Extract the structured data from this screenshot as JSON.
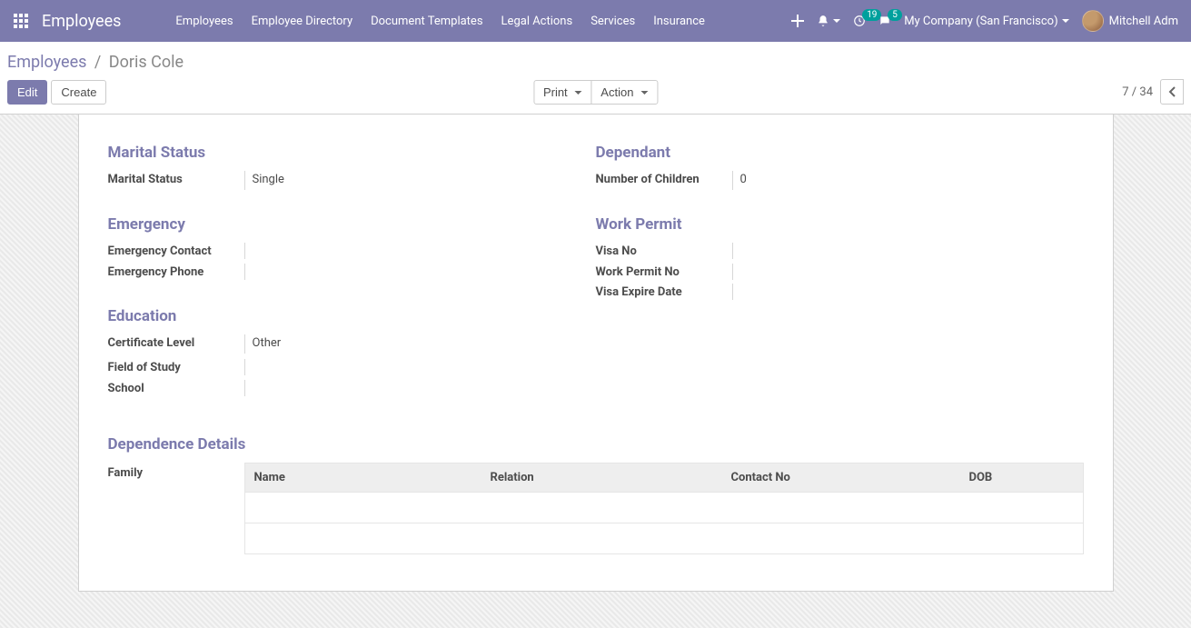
{
  "nav": {
    "brand": "Employees",
    "links": [
      "Employees",
      "Employee Directory",
      "Document Templates",
      "Legal Actions",
      "Services",
      "Insurance"
    ],
    "activity_count": "19",
    "discuss_count": "5",
    "company": "My Company (San Francisco)",
    "user": "Mitchell Adm"
  },
  "breadcrumb": {
    "root": "Employees",
    "sep": "/",
    "current": "Doris Cole"
  },
  "buttons": {
    "edit": "Edit",
    "create": "Create",
    "print": "Print",
    "action": "Action"
  },
  "pager": {
    "display": "7 / 34"
  },
  "sections": {
    "marital": {
      "title": "Marital Status",
      "fields": {
        "marital_status_label": "Marital Status",
        "marital_status_value": "Single"
      }
    },
    "dependant": {
      "title": "Dependant",
      "fields": {
        "num_children_label": "Number of Children",
        "num_children_value": "0"
      }
    },
    "emergency": {
      "title": "Emergency",
      "fields": {
        "contact_label": "Emergency Contact",
        "contact_value": "",
        "phone_label": "Emergency Phone",
        "phone_value": ""
      }
    },
    "work_permit": {
      "title": "Work Permit",
      "fields": {
        "visa_no_label": "Visa No",
        "visa_no_value": "",
        "permit_no_label": "Work Permit No",
        "permit_no_value": "",
        "visa_exp_label": "Visa Expire Date",
        "visa_exp_value": ""
      }
    },
    "education": {
      "title": "Education",
      "fields": {
        "cert_label": "Certificate Level",
        "cert_value": "Other",
        "field_label": "Field of Study",
        "field_value": "",
        "school_label": "School",
        "school_value": ""
      }
    },
    "dependence": {
      "title": "Dependence Details",
      "family_label": "Family",
      "columns": {
        "name": "Name",
        "relation": "Relation",
        "contact": "Contact No",
        "dob": "DOB"
      }
    }
  }
}
